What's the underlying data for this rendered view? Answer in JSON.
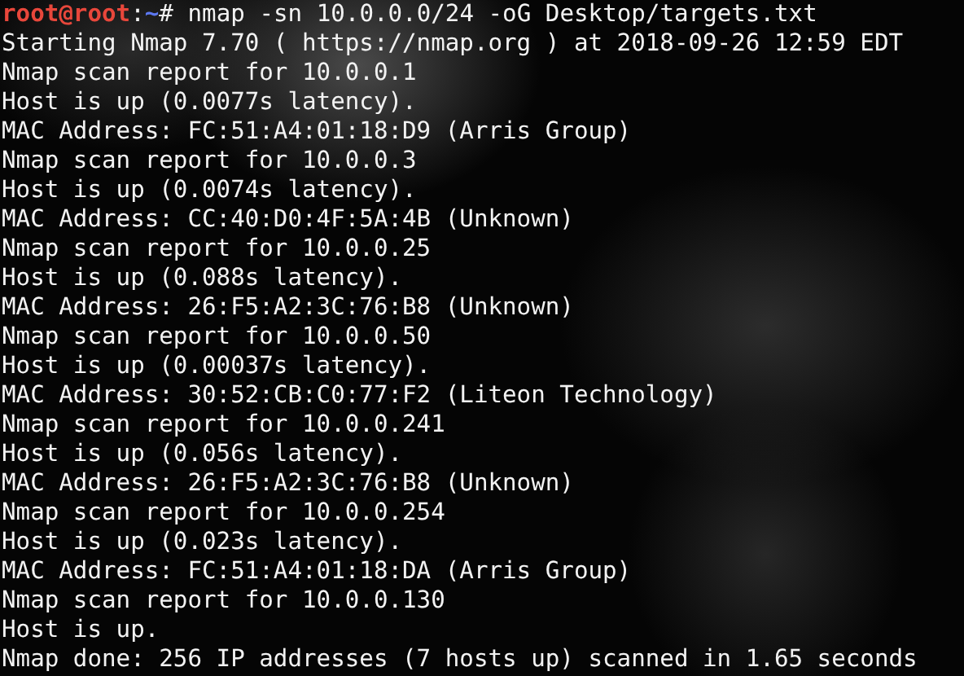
{
  "prompt": {
    "user": "root@root",
    "separator": ":",
    "path": "~",
    "symbol": "#",
    "command": "nmap -sn 10.0.0.0/24 -oG Desktop/targets.txt"
  },
  "output": [
    "Starting Nmap 7.70 ( https://nmap.org ) at 2018-09-26 12:59 EDT",
    "Nmap scan report for 10.0.0.1",
    "Host is up (0.0077s latency).",
    "MAC Address: FC:51:A4:01:18:D9 (Arris Group)",
    "Nmap scan report for 10.0.0.3",
    "Host is up (0.0074s latency).",
    "MAC Address: CC:40:D0:4F:5A:4B (Unknown)",
    "Nmap scan report for 10.0.0.25",
    "Host is up (0.088s latency).",
    "MAC Address: 26:F5:A2:3C:76:B8 (Unknown)",
    "Nmap scan report for 10.0.0.50",
    "Host is up (0.00037s latency).",
    "MAC Address: 30:52:CB:C0:77:F2 (Liteon Technology)",
    "Nmap scan report for 10.0.0.241",
    "Host is up (0.056s latency).",
    "MAC Address: 26:F5:A2:3C:76:B8 (Unknown)",
    "Nmap scan report for 10.0.0.254",
    "Host is up (0.023s latency).",
    "MAC Address: FC:51:A4:01:18:DA (Arris Group)",
    "Nmap scan report for 10.0.0.130",
    "Host is up.",
    "Nmap done: 256 IP addresses (7 hosts up) scanned in 1.65 seconds"
  ]
}
